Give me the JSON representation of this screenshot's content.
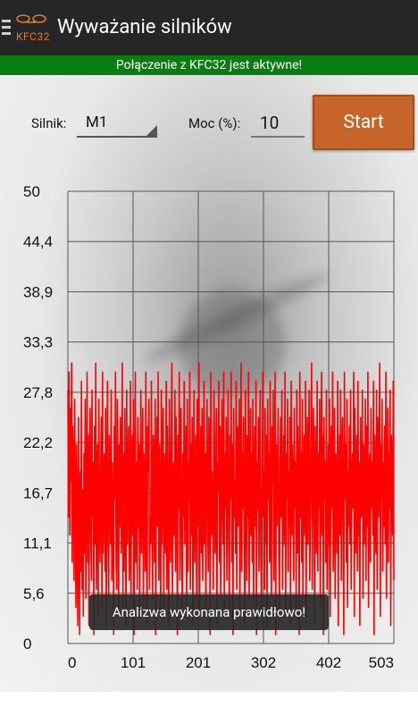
{
  "app": {
    "title": "Wyważanie silników",
    "logo_text": "KFC32"
  },
  "status": {
    "text": "Połączenie z KFC32 jest aktywne!",
    "color": "#0a7d12"
  },
  "controls": {
    "motor_label": "Silnik:",
    "motor_value": "M1",
    "power_label": "Moc (%):",
    "power_value": "10",
    "start_label": "Start"
  },
  "toast": {
    "text": "Analizwa wykonana prawidłowo!"
  },
  "colors": {
    "accent": "#c7642a",
    "line": "#ff0000"
  },
  "chart_data": {
    "type": "line",
    "title": "",
    "xlabel": "",
    "ylabel": "",
    "ylim": [
      0,
      50
    ],
    "xlim": [
      0,
      503
    ],
    "y_ticks": [
      "50",
      "44,4",
      "38,9",
      "33,3",
      "27,8",
      "22,2",
      "16,7",
      "11,1",
      "5,6",
      "0"
    ],
    "x_ticks": [
      "0",
      "101",
      "201",
      "302",
      "402",
      "503"
    ],
    "grid": true,
    "series": [
      {
        "name": "",
        "color": "#ff0000",
        "values": [
          28,
          14,
          30,
          12,
          26,
          18,
          31,
          9,
          24,
          20,
          7,
          27,
          16,
          4,
          22,
          11,
          2,
          25,
          13,
          1,
          19,
          8,
          29,
          6,
          17,
          3,
          21,
          10,
          27,
          5,
          15,
          30,
          9,
          23,
          2,
          18,
          26,
          12,
          7,
          28,
          14,
          20,
          1,
          24,
          11,
          31,
          6,
          16,
          22,
          3,
          27,
          13,
          9,
          19,
          25,
          4,
          30,
          10,
          17,
          21,
          8,
          26,
          2,
          15,
          29,
          12,
          5,
          23,
          18,
          11,
          28,
          7,
          20,
          14,
          1,
          24,
          16,
          30,
          9,
          6,
          27,
          19,
          3,
          22,
          13,
          25,
          10,
          17,
          31,
          4,
          21,
          8,
          26,
          15,
          2,
          28,
          11,
          19,
          24,
          7,
          14,
          29,
          5,
          18,
          23,
          12,
          27,
          1,
          16,
          30,
          9,
          20,
          6,
          25,
          13,
          22,
          3,
          18,
          28,
          10,
          15,
          26,
          4,
          21,
          17,
          8,
          30,
          12,
          2,
          24,
          19,
          27,
          6,
          14,
          11,
          29,
          16,
          5,
          23,
          20,
          9,
          27,
          1,
          18,
          25,
          13,
          30,
          7,
          22,
          15,
          3,
          28,
          11,
          19,
          26,
          4,
          21,
          16,
          10,
          29,
          6,
          24,
          13,
          2,
          27,
          17,
          9,
          22,
          31,
          5,
          14,
          20,
          12,
          28,
          8,
          25,
          18,
          1,
          23,
          15,
          30,
          7,
          19,
          26,
          10,
          4,
          21,
          14,
          29,
          11,
          17,
          24,
          3,
          27,
          8,
          20,
          16,
          30,
          6,
          22,
          12,
          25,
          2,
          18,
          28,
          9,
          15,
          23,
          5,
          27,
          13,
          20,
          31,
          4,
          17,
          24,
          10,
          26,
          7,
          14,
          29,
          11,
          21,
          3,
          18,
          27,
          15,
          8,
          25,
          22,
          1,
          30,
          12,
          19,
          16,
          6,
          28,
          23,
          10,
          14,
          26,
          2,
          20,
          17,
          29,
          9,
          24,
          5,
          13,
          27,
          18,
          11,
          30,
          3,
          21,
          15,
          25,
          7,
          19,
          28,
          12,
          4,
          23,
          16,
          30,
          9,
          22,
          1,
          26,
          14,
          18,
          10,
          29,
          6,
          24,
          13,
          20,
          27,
          3,
          17,
          31,
          8,
          21,
          15,
          25,
          11,
          2,
          28,
          19,
          7,
          23,
          14,
          30,
          5,
          16,
          26,
          12,
          21,
          9,
          27,
          4,
          18,
          24,
          13,
          29,
          1,
          20,
          15,
          25,
          8,
          22,
          28,
          10,
          3,
          17,
          30,
          14,
          19,
          6,
          26,
          11,
          23,
          2,
          27,
          16,
          21,
          9,
          29,
          12,
          5,
          24,
          18,
          28,
          7,
          15,
          30,
          1,
          22,
          13,
          19,
          26,
          10,
          4,
          20,
          25,
          14,
          28,
          6,
          17,
          23,
          11,
          30,
          3,
          21,
          16,
          27,
          8,
          19,
          13,
          25,
          2,
          29,
          12,
          22,
          18,
          7,
          26,
          15,
          20,
          4,
          28,
          10,
          24,
          17,
          1,
          30,
          14,
          21,
          9,
          27,
          5,
          18,
          23,
          12,
          29,
          3,
          16,
          25,
          11,
          20,
          28,
          7,
          14,
          22,
          31,
          6,
          19,
          26,
          13,
          2,
          24,
          17,
          10,
          29,
          8,
          21,
          15,
          27,
          4,
          18,
          30,
          12,
          23,
          1,
          25,
          16,
          20,
          9,
          28,
          6,
          14,
          22,
          11,
          27,
          3,
          19,
          24,
          15,
          30,
          8,
          13,
          26,
          5,
          21,
          18,
          10,
          29,
          2,
          17,
          23,
          12,
          28,
          7,
          20,
          25,
          14,
          1,
          30,
          16,
          22,
          9,
          27,
          4,
          19,
          13,
          24,
          11,
          28,
          6,
          18,
          21,
          15,
          30,
          3,
          26,
          10,
          17,
          23,
          8,
          29,
          12,
          20,
          2,
          25,
          16,
          14,
          28,
          5,
          22,
          19,
          11,
          27,
          7,
          24,
          13,
          30,
          4,
          18,
          21,
          9,
          26,
          15,
          20,
          12,
          29,
          1,
          23,
          17,
          10,
          28,
          6,
          25,
          14,
          19,
          31,
          3,
          22,
          16,
          27,
          8,
          20,
          13,
          24,
          11,
          30,
          5,
          18,
          26,
          9,
          21,
          15,
          28,
          2,
          23,
          17,
          12,
          29,
          7
        ]
      }
    ]
  }
}
